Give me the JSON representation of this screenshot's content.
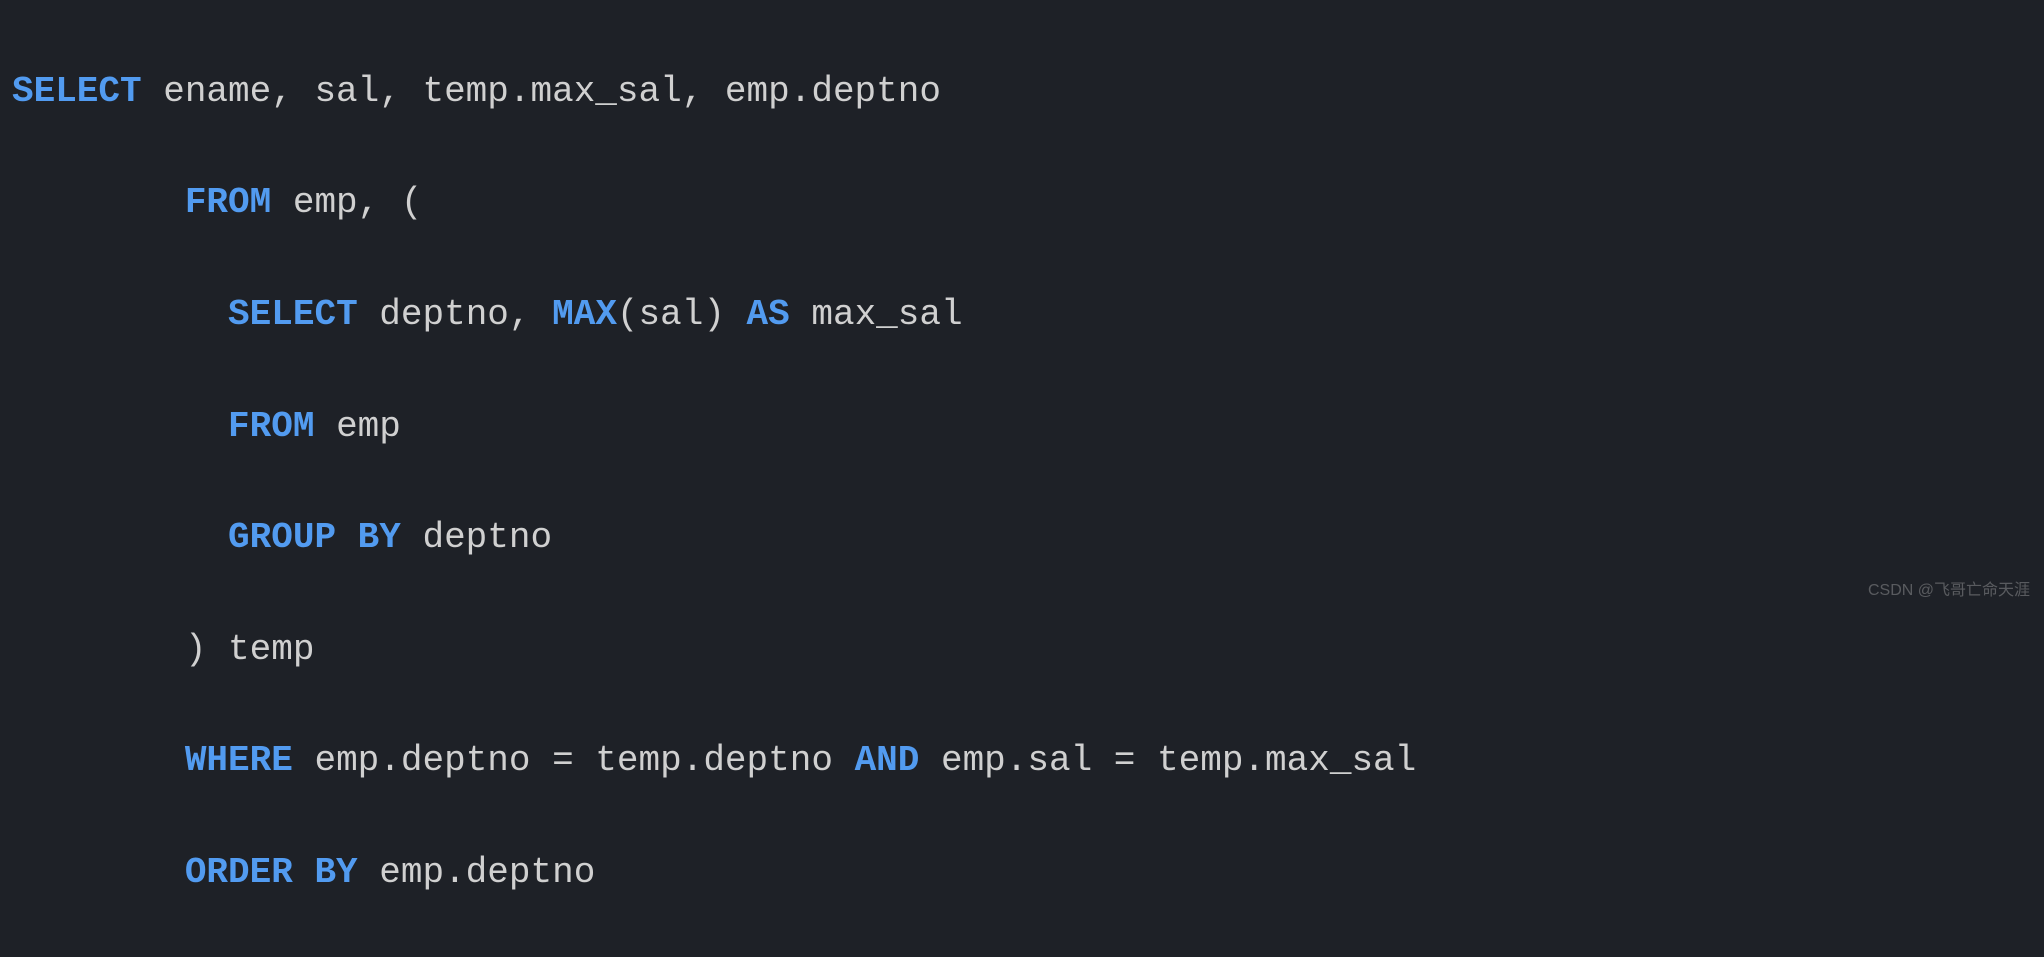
{
  "code": {
    "line1": {
      "kw_select": "SELECT",
      "cols": " ename, sal, temp.max_sal, emp.deptno"
    },
    "line2": {
      "indent": "        ",
      "kw_from": "FROM",
      "rest": " emp, ("
    },
    "line3": {
      "indent": "          ",
      "kw_select": "SELECT",
      "col1": " deptno, ",
      "fn_max": "MAX",
      "args": "(sal) ",
      "kw_as": "AS",
      "alias": " max_sal"
    },
    "line4": {
      "indent": "          ",
      "kw_from": "FROM",
      "table": " emp"
    },
    "line5": {
      "indent": "          ",
      "kw_group": "GROUP BY",
      "col": " deptno"
    },
    "line6": {
      "indent": "        ",
      "close": ") temp"
    },
    "line7": {
      "indent": "        ",
      "kw_where": "WHERE",
      "cond1": " emp.deptno = temp.deptno ",
      "kw_and": "AND",
      "cond2": " emp.sal = temp.max_sal"
    },
    "line8": {
      "indent": "        ",
      "kw_order": "ORDER BY",
      "col": " emp.deptno"
    }
  },
  "watermark": "CSDN @飞哥亡命天涯"
}
